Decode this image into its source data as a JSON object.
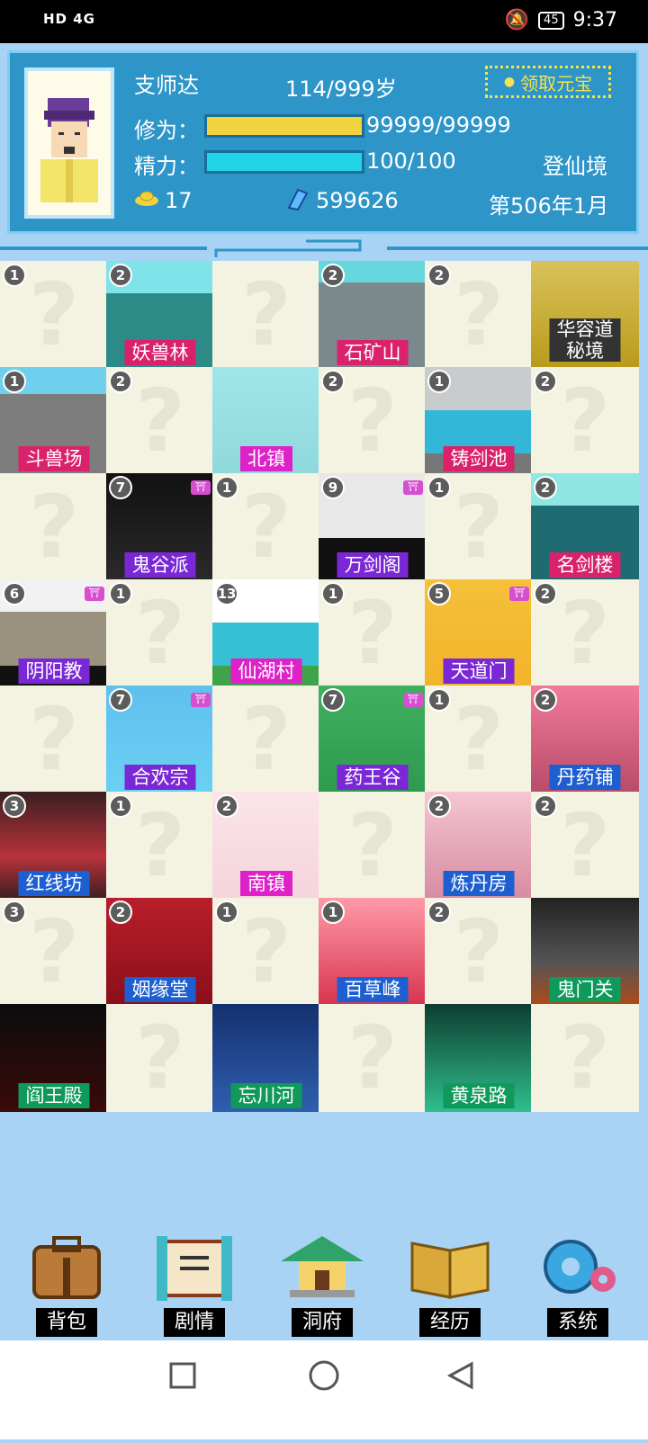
{
  "status_bar": {
    "left": "HD 4G",
    "battery": "45",
    "time": "9:37"
  },
  "player": {
    "name": "支师达",
    "age": "114/999岁",
    "claim_label": "领取元宝",
    "cultivation_label": "修为：",
    "cultivation_value": "99999/99999",
    "cultivation_fraction": 1.0,
    "stamina_label": "精力：",
    "stamina_value": "100/100",
    "stamina_fraction": 1.0,
    "realm": "登仙境",
    "gold": "17",
    "spirit_stones": "599626",
    "date": "第506年1月"
  },
  "colors": {
    "cultivation": "#f2d33f",
    "stamina": "#22d4e7",
    "panel": "#2e95c9"
  },
  "cells": [
    {
      "count": "1",
      "label": "",
      "color": "",
      "bg": "empty"
    },
    {
      "count": "2",
      "label": "妖兽林",
      "color": "#d9226b",
      "bg": "forest"
    },
    {
      "count": "",
      "label": "",
      "color": "",
      "bg": "empty"
    },
    {
      "count": "2",
      "label": "石矿山",
      "color": "#d9226b",
      "bg": "mountain"
    },
    {
      "count": "2",
      "label": "",
      "color": "",
      "bg": "empty"
    },
    {
      "count": "",
      "label": "华容道\n秘境",
      "color": "#333333",
      "bg": "puzzle"
    },
    {
      "count": "1",
      "label": "斗兽场",
      "color": "#d9226b",
      "bg": "arena"
    },
    {
      "count": "2",
      "label": "",
      "color": "",
      "bg": "empty"
    },
    {
      "count": "",
      "label": "北镇",
      "color": "#de22c8",
      "bg": "stone"
    },
    {
      "count": "2",
      "label": "",
      "color": "",
      "bg": "empty"
    },
    {
      "count": "1",
      "label": "铸剑池",
      "color": "#d9226b",
      "bg": "pool"
    },
    {
      "count": "2",
      "label": "",
      "color": "",
      "bg": "empty"
    },
    {
      "count": "",
      "label": "",
      "color": "",
      "bg": "empty"
    },
    {
      "count": "7",
      "label": "鬼谷派",
      "color": "#7a28d6",
      "bg": "ghost",
      "badge": "iii"
    },
    {
      "count": "1",
      "label": "",
      "color": "",
      "bg": "empty"
    },
    {
      "count": "9",
      "label": "万剑阁",
      "color": "#7a28d6",
      "bg": "swords",
      "badge": "iii"
    },
    {
      "count": "1",
      "label": "",
      "color": "",
      "bg": "empty"
    },
    {
      "count": "2",
      "label": "名剑楼",
      "color": "#d9226b",
      "bg": "pagoda"
    },
    {
      "count": "6",
      "label": "阴阳教",
      "color": "#7a28d6",
      "bg": "yinyang",
      "badge": "iii"
    },
    {
      "count": "1",
      "label": "",
      "color": "",
      "bg": "empty"
    },
    {
      "count": "13",
      "label": "仙湖村",
      "color": "#de22c8",
      "bg": "village"
    },
    {
      "count": "1",
      "label": "",
      "color": "",
      "bg": "empty"
    },
    {
      "count": "5",
      "label": "天道门",
      "color": "#7a28d6",
      "bg": "taiji",
      "badge": "iii"
    },
    {
      "count": "2",
      "label": "",
      "color": "",
      "bg": "empty"
    },
    {
      "count": "",
      "label": "",
      "color": "",
      "bg": "empty"
    },
    {
      "count": "7",
      "label": "合欢宗",
      "color": "#7a28d6",
      "bg": "rose",
      "badge": "iii"
    },
    {
      "count": "",
      "label": "",
      "color": "",
      "bg": "empty"
    },
    {
      "count": "7",
      "label": "药王谷",
      "color": "#7a28d6",
      "bg": "gourd",
      "badge": "iii"
    },
    {
      "count": "1",
      "label": "",
      "color": "",
      "bg": "empty"
    },
    {
      "count": "2",
      "label": "丹药铺",
      "color": "#1d5fd0",
      "bg": "shop"
    },
    {
      "count": "3",
      "label": "红线坊",
      "color": "#1d5fd0",
      "bg": "lanterns"
    },
    {
      "count": "1",
      "label": "",
      "color": "",
      "bg": "empty"
    },
    {
      "count": "2",
      "label": "南镇",
      "color": "#de22c8",
      "bg": "jar"
    },
    {
      "count": "",
      "label": "",
      "color": "",
      "bg": "empty"
    },
    {
      "count": "2",
      "label": "炼丹房",
      "color": "#1d5fd0",
      "bg": "cauldron"
    },
    {
      "count": "2",
      "label": "",
      "color": "",
      "bg": "empty"
    },
    {
      "count": "3",
      "label": "",
      "color": "",
      "bg": "empty"
    },
    {
      "count": "2",
      "label": "姻缘堂",
      "color": "#1d5fd0",
      "bg": "wedding"
    },
    {
      "count": "1",
      "label": "",
      "color": "",
      "bg": "empty"
    },
    {
      "count": "1",
      "label": "百草峰",
      "color": "#1d5fd0",
      "bg": "herbs"
    },
    {
      "count": "2",
      "label": "",
      "color": "",
      "bg": "empty"
    },
    {
      "count": "",
      "label": "鬼门关",
      "color": "#0f9a5c",
      "bg": "gate"
    },
    {
      "count": "",
      "label": "阎王殿",
      "color": "#0f9a5c",
      "bg": "hell"
    },
    {
      "count": "",
      "label": "",
      "color": "",
      "bg": "empty"
    },
    {
      "count": "",
      "label": "忘川河",
      "color": "#0f9a5c",
      "bg": "river"
    },
    {
      "count": "",
      "label": "",
      "color": "",
      "bg": "empty"
    },
    {
      "count": "",
      "label": "黄泉路",
      "color": "#0f9a5c",
      "bg": "yellowroad"
    },
    {
      "count": "",
      "label": "",
      "color": "",
      "bg": "empty"
    }
  ],
  "bottom_menu": [
    {
      "label": "背包",
      "icon": "bag-icon"
    },
    {
      "label": "剧情",
      "icon": "scroll-icon"
    },
    {
      "label": "洞府",
      "icon": "pavilion-icon"
    },
    {
      "label": "经历",
      "icon": "book-icon"
    },
    {
      "label": "系统",
      "icon": "gear-icon"
    }
  ]
}
